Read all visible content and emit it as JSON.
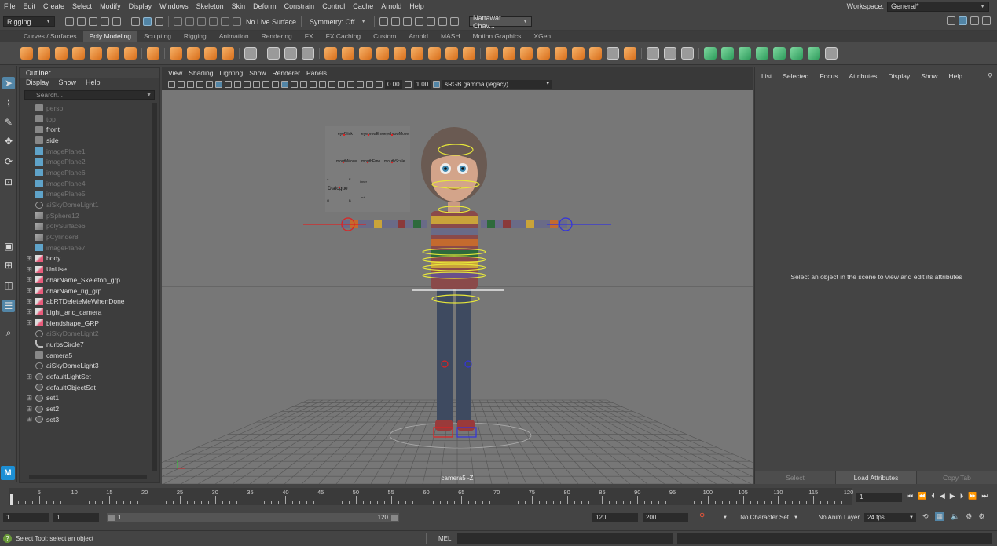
{
  "menubar": {
    "items": [
      "File",
      "Edit",
      "Create",
      "Select",
      "Modify",
      "Display",
      "Windows",
      "Skeleton",
      "Skin",
      "Deform",
      "Constrain",
      "Control",
      "Cache",
      "Arnold",
      "Help"
    ],
    "workspace_label": "Workspace:",
    "workspace_value": "General*"
  },
  "statusline": {
    "mode_menu": "Rigging",
    "live_surface": "No Live Surface",
    "symmetry": "Symmetry: Off",
    "user": "Nattawat Chav..."
  },
  "shelf": {
    "tabs": [
      "Curves / Surfaces",
      "Poly Modeling",
      "Sculpting",
      "Rigging",
      "Animation",
      "Rendering",
      "FX",
      "FX Caching",
      "Custom",
      "Arnold",
      "MASH",
      "Motion Graphics",
      "XGen"
    ],
    "active_tab": "Poly Modeling"
  },
  "outliner": {
    "title": "Outliner",
    "menu": [
      "Display",
      "Show",
      "Help"
    ],
    "search_placeholder": "Search...",
    "items": [
      {
        "label": "persp",
        "icon": "camera-icon",
        "dim": true,
        "expandable": false
      },
      {
        "label": "top",
        "icon": "camera-icon",
        "dim": true,
        "expandable": false
      },
      {
        "label": "front",
        "icon": "camera-icon",
        "dim": false,
        "expandable": false
      },
      {
        "label": "side",
        "icon": "camera-icon",
        "dim": false,
        "expandable": false
      },
      {
        "label": "imagePlane1",
        "icon": "image-plane-icon",
        "dim": true,
        "expandable": false
      },
      {
        "label": "imagePlane2",
        "icon": "image-plane-icon",
        "dim": true,
        "expandable": false
      },
      {
        "label": "imagePlane6",
        "icon": "image-plane-icon",
        "dim": true,
        "expandable": false
      },
      {
        "label": "imagePlane4",
        "icon": "image-plane-icon",
        "dim": true,
        "expandable": false
      },
      {
        "label": "imagePlane5",
        "icon": "image-plane-icon",
        "dim": true,
        "expandable": false
      },
      {
        "label": "aiSkyDomeLight1",
        "icon": "light-icon",
        "dim": true,
        "expandable": false
      },
      {
        "label": "pSphere12",
        "icon": "mesh-icon",
        "dim": true,
        "expandable": false
      },
      {
        "label": "polySurface6",
        "icon": "mesh-icon",
        "dim": true,
        "expandable": false
      },
      {
        "label": "pCylinder8",
        "icon": "mesh-icon",
        "dim": true,
        "expandable": false
      },
      {
        "label": "imagePlane7",
        "icon": "image-plane-icon",
        "dim": true,
        "expandable": false
      },
      {
        "label": "body",
        "icon": "group-icon",
        "dim": false,
        "expandable": true
      },
      {
        "label": "UnUse",
        "icon": "group-icon",
        "dim": false,
        "expandable": true
      },
      {
        "label": "charName_Skeleton_grp",
        "icon": "group-icon",
        "dim": false,
        "expandable": true
      },
      {
        "label": "charName_rig_grp",
        "icon": "group-icon",
        "dim": false,
        "expandable": true
      },
      {
        "label": "abRTDeleteMeWhenDone",
        "icon": "group-icon",
        "dim": false,
        "expandable": true
      },
      {
        "label": "Light_and_camera",
        "icon": "group-icon",
        "dim": false,
        "expandable": true
      },
      {
        "label": "blendshape_GRP",
        "icon": "group-icon",
        "dim": false,
        "expandable": true
      },
      {
        "label": "aiSkyDomeLight2",
        "icon": "light-icon",
        "dim": true,
        "expandable": false
      },
      {
        "label": "nurbsCircle7",
        "icon": "curve-icon",
        "dim": false,
        "expandable": false
      },
      {
        "label": "camera5",
        "icon": "camera-icon",
        "dim": false,
        "expandable": false
      },
      {
        "label": "aiSkyDomeLight3",
        "icon": "light-icon",
        "dim": false,
        "expandable": false
      },
      {
        "label": "defaultLightSet",
        "icon": "set-icon",
        "dim": false,
        "expandable": true
      },
      {
        "label": "defaultObjectSet",
        "icon": "set-icon",
        "dim": false,
        "expandable": false
      },
      {
        "label": "set1",
        "icon": "set-icon",
        "dim": false,
        "expandable": true
      },
      {
        "label": "set2",
        "icon": "set-icon",
        "dim": false,
        "expandable": true
      },
      {
        "label": "set3",
        "icon": "set-icon",
        "dim": false,
        "expandable": true
      }
    ]
  },
  "viewport": {
    "menu": [
      "View",
      "Shading",
      "Lighting",
      "Show",
      "Renderer",
      "Panels"
    ],
    "near_value": "0.00",
    "far_value": "1.00",
    "color_space": "sRGB gamma (legacy)",
    "camera_label": "camera5 -Z",
    "face_controls": {
      "row1": [
        "eyeBlink",
        "eyebrowEmo",
        "eyebrowMove"
      ],
      "row2": [
        "mouthMove",
        "mouthEmo",
        "mouthScale"
      ],
      "dialogue_label": "Dialogue",
      "small_letters": [
        "A",
        "F",
        "O",
        "B",
        "inner",
        "pull"
      ]
    }
  },
  "attribute_editor": {
    "menu": [
      "List",
      "Selected",
      "Focus",
      "Attributes",
      "Display",
      "Show",
      "Help"
    ],
    "message": "Select an object in the scene to view and edit its attributes",
    "buttons": [
      "Select",
      "Load Attributes",
      "Copy Tab"
    ]
  },
  "timeslider": {
    "ticks": [
      1,
      5,
      10,
      15,
      20,
      25,
      30,
      35,
      40,
      45,
      50,
      55,
      60,
      65,
      70,
      75,
      80,
      85,
      90,
      95,
      100,
      105,
      110,
      115,
      120
    ],
    "current_frame": "1"
  },
  "rangeslider": {
    "start": "1",
    "start_inner": "1",
    "range_start": "1",
    "range_end": "120",
    "end_inner": "120",
    "end": "200",
    "character_set": "No Character Set",
    "anim_layer": "No Anim Layer",
    "fps": "24 fps"
  },
  "commandline": {
    "mode": "MEL",
    "help_text": "Select Tool: select an object"
  },
  "colors": {
    "accent": "#5285a6",
    "viewport_bg": "#777777",
    "maya_logo": "#1d8fd4"
  }
}
